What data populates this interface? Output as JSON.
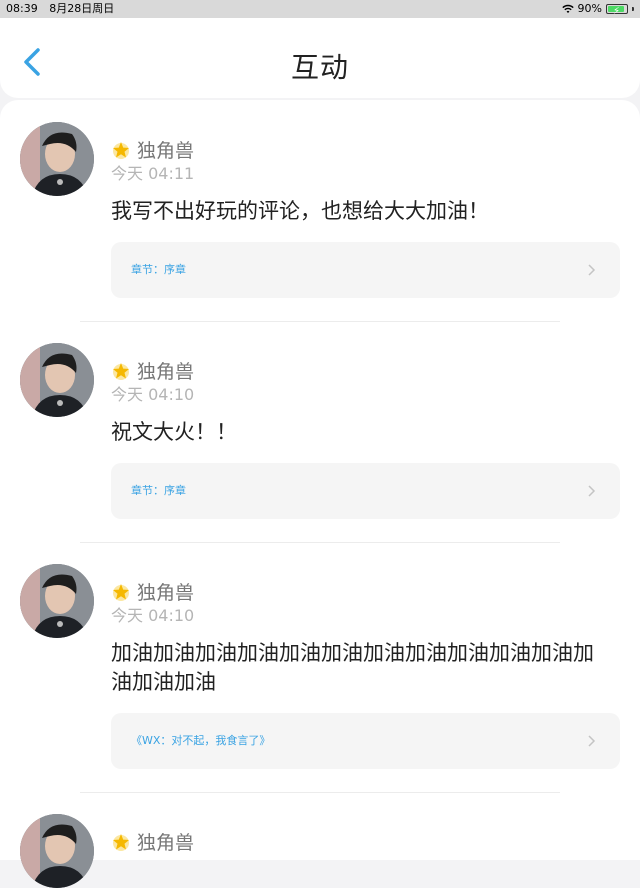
{
  "statusbar": {
    "time": "08:39",
    "date": "8月28日周日",
    "battery": "90%"
  },
  "nav": {
    "title": "互动",
    "back_icon": "chevron-left-icon"
  },
  "colors": {
    "accent": "#3aa3e3",
    "badge": "#f5b800"
  },
  "items": [
    {
      "name": "独角兽",
      "time": "今天 04:11",
      "comment": "我写不出好玩的评论，也想给大大加油！",
      "chapter": "章节：序章"
    },
    {
      "name": "独角兽",
      "time": "今天 04:10",
      "comment": "祝文大火！！",
      "chapter": "章节：序章"
    },
    {
      "name": "独角兽",
      "time": "今天 04:10",
      "comment": "加油加油加油加油加油加油加油加油加油加油加油加油加油加油",
      "chapter": "《WX：对不起，我食言了》"
    },
    {
      "name": "独角兽"
    }
  ]
}
